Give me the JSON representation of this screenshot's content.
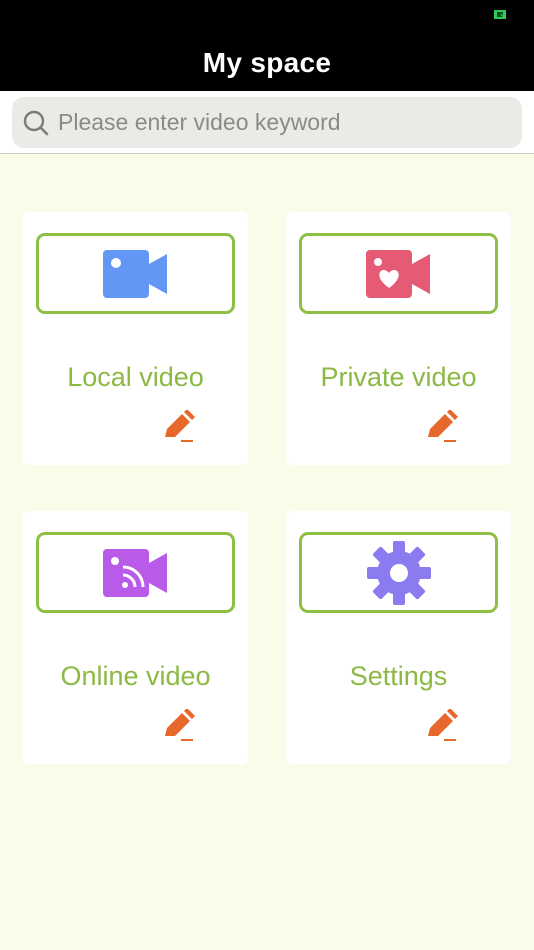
{
  "header": {
    "title": "My space"
  },
  "search": {
    "placeholder": "Please enter video keyword",
    "value": ""
  },
  "colors": {
    "accent_green": "#8fbe45",
    "label_green": "#8cb844",
    "edit_orange": "#e8672a",
    "local_blue": "#6496f5",
    "private_pink": "#e55a75",
    "online_purple": "#b95ae8",
    "settings_violet": "#8a7cf0"
  },
  "cards": [
    {
      "label": "Local video",
      "icon": "video-camera-icon"
    },
    {
      "label": "Private video",
      "icon": "video-heart-icon"
    },
    {
      "label": "Online video",
      "icon": "video-rss-icon"
    },
    {
      "label": "Settings",
      "icon": "gear-icon"
    }
  ]
}
